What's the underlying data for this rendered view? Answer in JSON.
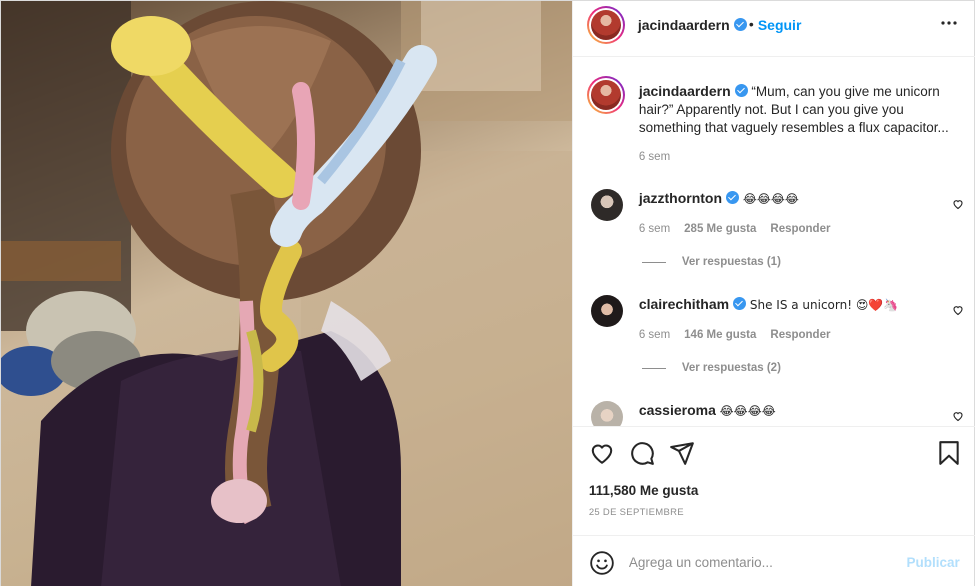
{
  "header": {
    "username": "jacindaardern",
    "separator": "•",
    "follow_label": "Seguir",
    "more_label": "•••"
  },
  "caption": {
    "username": "jacindaardern",
    "text": "“Mum, can you give me unicorn hair?” Apparently not. But I can you give you something that vaguely resembles a flux capacitor...",
    "time": "6 sem"
  },
  "comments": [
    {
      "username": "jazzthornton",
      "text": "😂😂😂😂",
      "time": "6 sem",
      "likes": "285 Me gusta",
      "reply_label": "Responder",
      "view_replies": "Ver respuestas (1)"
    },
    {
      "username": "clairechitham",
      "text": "She IS a unicorn! 😍❤️🦄",
      "time": "6 sem",
      "likes": "146 Me gusta",
      "reply_label": "Responder",
      "view_replies": "Ver respuestas (2)"
    },
    {
      "username": "cassieroma",
      "text": "😂😂😂😂"
    }
  ],
  "actions": {
    "likes_count": "111,580 Me gusta",
    "date": "25 DE SEPTIEMBRE"
  },
  "add_comment": {
    "placeholder": "Agrega un comentario...",
    "publish_label": "Publicar"
  },
  "colors": {
    "accent": "#0095f6",
    "verified": "#3897f0",
    "muted": "#8e8e8e",
    "publish_disabled": "#b2dffc"
  },
  "icons": [
    "verified-badge-icon",
    "more-options-icon",
    "heart-icon",
    "comment-icon",
    "share-icon",
    "bookmark-icon",
    "emoji-icon"
  ]
}
